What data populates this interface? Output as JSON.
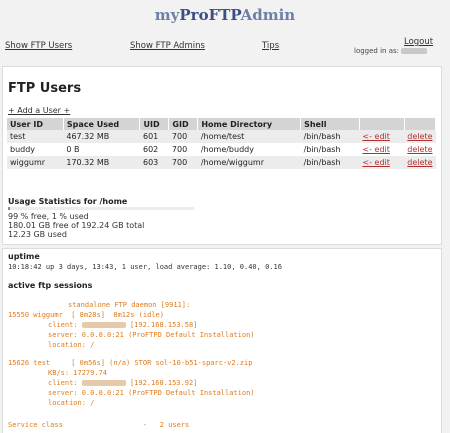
{
  "app": {
    "title_prefix": "my",
    "title_main": "ProFTP",
    "title_suffix": "Admin"
  },
  "nav": {
    "show_ftp_users": "Show FTP Users",
    "show_ftp_admins": "Show FTP Admins",
    "tips": "Tips",
    "logout": "Logout",
    "logged_in_as": "logged in as:"
  },
  "users_panel": {
    "title": "FTP Users",
    "add_user": "+ Add a User +",
    "columns": [
      "User ID",
      "Space Used",
      "UID",
      "GID",
      "Home Directory",
      "Shell"
    ],
    "rows": [
      {
        "user": "test",
        "space": "467.32 MB",
        "uid": "601",
        "gid": "700",
        "home": "/home/test",
        "shell": "/bin/bash",
        "edit": "<- edit",
        "delete": "delete"
      },
      {
        "user": "buddy",
        "space": "0 B",
        "uid": "602",
        "gid": "700",
        "home": "/home/buddy",
        "shell": "/bin/bash",
        "edit": "<- edit",
        "delete": "delete"
      },
      {
        "user": "wiggumr",
        "space": "170.32 MB",
        "uid": "603",
        "gid": "700",
        "home": "/home/wiggumr",
        "shell": "/bin/bash",
        "edit": "<- edit",
        "delete": "delete"
      }
    ],
    "usage_title": "Usage Statistics for /home",
    "usage_fraction_used": 0.01,
    "usage_line1": "99 % free, 1 % used",
    "usage_line2": "180.01 GB free of 192.24 GB total",
    "usage_line3": "12.23 GB used"
  },
  "status_panel": {
    "uptime_title": "uptime",
    "uptime_line": "10:18:42 up 3 days, 13:43, 1 user, load average: 1.10, 0.40, 0.16",
    "sessions_title": "active ftp sessions",
    "daemon_line": "standalone FTP daemon [9911]:",
    "s1_line": "15550 wiggumr  [ 8m28s]  8m12s (idle)",
    "s1_client_label": "client:",
    "s1_client_ip": "[192.168.153.58]",
    "s1_server": "server: 0.0.0.0:21 (ProFTPD Default Installation)",
    "s1_location": "location: /",
    "s2_line": "15626 test     [ 0m56s] (n/a) STOR sol-10-b51-sparc-v2.zip",
    "s2_rate": "KB/s: 17279.74",
    "s2_client_label": "client:",
    "s2_client_ip": "[192.168.153.92]",
    "s2_server": "server: 0.0.0.0:21 (ProFTPD Default Installation)",
    "s2_location": "location: /",
    "service_class": "Service class                   -   2 users"
  }
}
